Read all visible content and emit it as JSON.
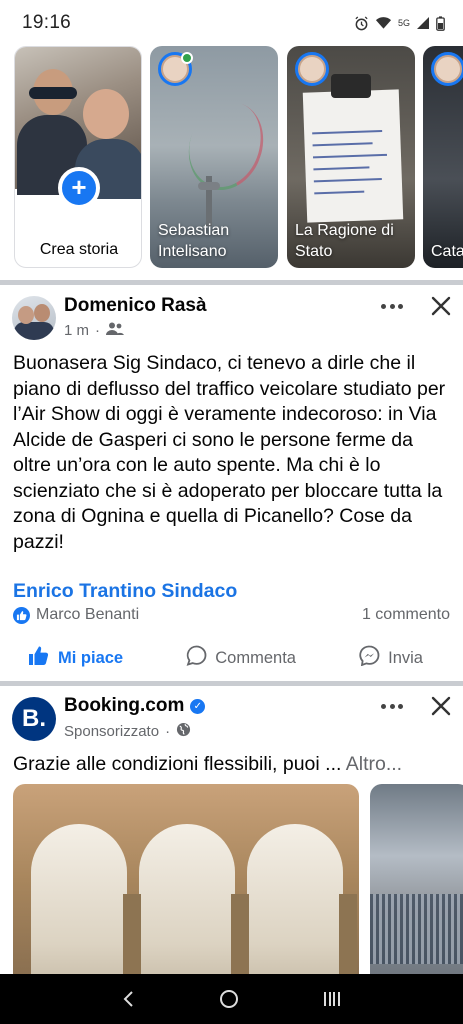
{
  "status_bar": {
    "time": "19:16",
    "network": "5G",
    "icons": [
      "alarm-icon",
      "wifi-icon",
      "signal-icon",
      "battery-icon"
    ]
  },
  "stories": {
    "create_label": "Crea storia",
    "items": [
      {
        "name": "Sebastian Intelisano"
      },
      {
        "name": "La Ragione di Stato"
      },
      {
        "name": "Cata"
      }
    ]
  },
  "post1": {
    "author": "Domenico Rasà",
    "time": "1 m",
    "audience_icon": "friends-icon",
    "text": "Buonasera Sig Sindaco, ci tenevo a dirle che il piano di deflusso del traffico veicolare studiato per l’Air Show di oggi è veramente indecoroso: in Via Alcide de Gasperi ci sono le persone ferme da oltre un’ora con le auto spente. Ma chi è lo scienziato che si è adoperato per bloccare tutta la zona di Ognina e quella di Picanello? Cose da pazzi!",
    "tagged_page": "Enrico Trantino Sindaco",
    "reaction_by": "Marco Benanti",
    "comments": "1 commento",
    "actions": {
      "like": "Mi piace",
      "comment": "Commenta",
      "share": "Invia"
    }
  },
  "post2": {
    "author": "Booking.com",
    "avatar_letter": "B.",
    "sponsored": "Sponsorizzato",
    "text": "Grazie alle condizioni flessibili, puoi ...",
    "more": "Altro..."
  },
  "colors": {
    "accent": "#1877f2",
    "link": "#1b74e4",
    "booking": "#003580",
    "muted": "#65676b"
  }
}
